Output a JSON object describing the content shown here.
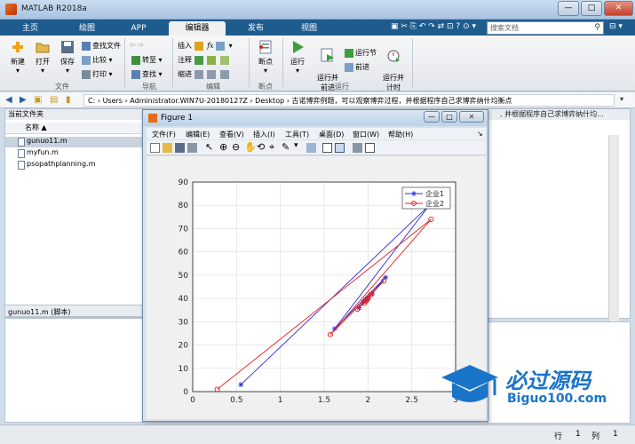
{
  "app": {
    "title": "MATLAB R2018a"
  },
  "ribbon_tabs": [
    "主页",
    "绘图",
    "APP",
    "编辑器",
    "发布",
    "视图"
  ],
  "search": {
    "placeholder": "搜索文档"
  },
  "ribbon": {
    "new": "新建",
    "open": "打开",
    "save": "保存",
    "find_file": "查找文件",
    "compare": "比较",
    "print": "打印",
    "goto": "转至",
    "find": "查找",
    "insert": "插入",
    "comment": "注释",
    "indent": "缩进",
    "breakpoint": "断点",
    "run": "运行",
    "run_advance": "运行并\n前进",
    "run_section": "运行节",
    "advance": "前进",
    "run_time": "运行并\n计时",
    "groups": {
      "file": "文件",
      "nav": "导航",
      "edit": "编辑",
      "breakpoint": "断点",
      "run": "运行"
    }
  },
  "address": {
    "path": "C:  ›  Users  ›  Administrator.WIN7U-20180127Z  ›  Desktop  ›  古诺博弈例题，可以观察博弈过程，并根据程序自己求博弈纳什均衡点"
  },
  "current_folder": {
    "header": "当前文件夹",
    "column": "名称 ▲",
    "files": [
      "gunuo11.m",
      "myfun.m",
      "psopathplanning.m"
    ],
    "details": "gunuo11.m  (脚本)"
  },
  "editor": {
    "tab_title": ", 并根据程序自己求博弈纳什均..."
  },
  "status": {
    "row_label": "行",
    "row_value": "1",
    "col_label": "列",
    "col_value": "1"
  },
  "figure": {
    "title": "Figure 1",
    "menus": [
      "文件(F)",
      "编辑(E)",
      "查看(V)",
      "插入(I)",
      "工具(T)",
      "桌面(D)",
      "窗口(W)",
      "帮助(H)"
    ]
  },
  "chart_data": {
    "type": "line",
    "title": "",
    "xlabel": "",
    "ylabel": "",
    "xlim": [
      0,
      3
    ],
    "ylim": [
      0,
      90
    ],
    "xticks": [
      "0",
      "0.5",
      "1",
      "1.5",
      "2",
      "2.5",
      "3"
    ],
    "yticks": [
      "0",
      "10",
      "20",
      "30",
      "40",
      "50",
      "60",
      "70",
      "80",
      "90"
    ],
    "grid": true,
    "legend": "top-right",
    "series": [
      {
        "name": "企业1",
        "color": "#2c2cd6",
        "marker": "star",
        "x": [
          0.55,
          2.7,
          1.62,
          2.2,
          1.9,
          2.05,
          1.95,
          2.0,
          1.97,
          1.99
        ],
        "y": [
          3.0,
          80.0,
          27.0,
          49.0,
          36.0,
          42.0,
          38.5,
          40.5,
          39.5,
          40.0
        ]
      },
      {
        "name": "企业2",
        "color": "#e02020",
        "marker": "circle",
        "x": [
          0.28,
          2.72,
          1.57,
          2.18,
          1.88,
          2.03,
          1.96,
          2.0,
          1.98,
          1.99
        ],
        "y": [
          1.0,
          74.0,
          24.5,
          47.5,
          35.5,
          41.5,
          38.0,
          40.0,
          39.0,
          39.5
        ]
      }
    ]
  },
  "watermark": {
    "brand": "必过源码",
    "url": "Biguo100.com"
  },
  "colors": {
    "tabbar": "#1f5c8e",
    "accent": "#2c2cd6"
  }
}
